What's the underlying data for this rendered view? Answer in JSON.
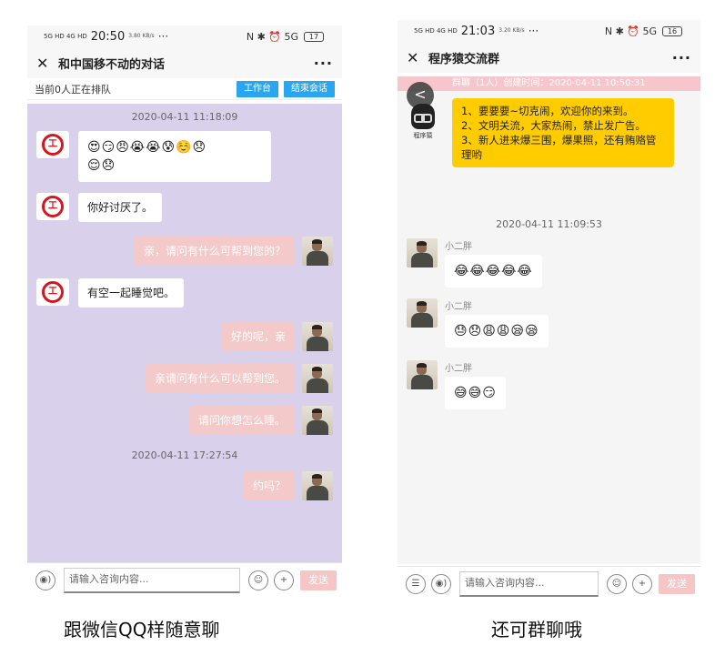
{
  "left": {
    "status": {
      "signal": "5G HD 4G HD",
      "time": "20:50",
      "speed": "3.80 KB/s",
      "dots": "···",
      "icons": "N ✱ ⏰ 5G",
      "battery": "17"
    },
    "title": "和中国移不动的对话",
    "close_icon": "✕",
    "more_icon": "···",
    "queue_text": "当前0人正在排队",
    "btn_workbench": "工作台",
    "btn_end": "结束会话",
    "time1": "2020-04-11 11:18:09",
    "msg1": "😍😏😠😭😭😰☺️😞",
    "msg1b": "😌😞",
    "msg2": "你好讨厌了。",
    "msg3": "亲，请问有什么可帮到您的？",
    "msg4": "有空一起睡觉吧。",
    "msg5": "好的呢，亲",
    "msg6": "亲请问有什么可以帮到您。",
    "msg7": "请问你想怎么睡。",
    "time2": "2020-04-11 17:27:54",
    "msg8": "约吗？",
    "logo_text": "ICBC",
    "input_placeholder": "请输入咨询内容...",
    "send": "发送"
  },
  "right": {
    "status": {
      "signal": "5G HD 4G HD",
      "time": "21:03",
      "speed": "3.20 KB/s",
      "dots": "···",
      "icons": "N ✱ ⏰ 5G",
      "battery": "16"
    },
    "title": "程序猿交流群",
    "close_icon": "✕",
    "more_icon": "···",
    "banner": "群聊（1人）创建时间：2020-04-11 10:50:31",
    "back_icon": "<",
    "coder_label": "程序猿",
    "notice": [
      "1、要要要~切克闹，欢迎你的来到。",
      "2、文明关流，大家热闹，禁止发广告。",
      "3、新人进来爆三围，爆果照，还有贿赂管理哟"
    ],
    "time1": "2020-04-11 11:09:53",
    "sender": "小二胖",
    "msg1": "😂😂😂😂😂",
    "msg2": "😓😞😩😩😪😪",
    "msg3": "😅😅😏",
    "input_placeholder": "请输入咨询内容...",
    "send": "发送"
  },
  "captions": {
    "left": "跟微信QQ样随意聊",
    "right": "还可群聊哦"
  }
}
